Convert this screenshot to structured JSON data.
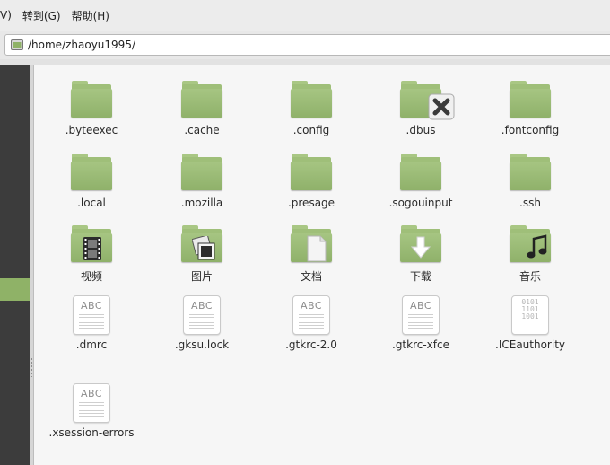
{
  "menu": [
    "V)",
    "转到(G)",
    "帮助(H)"
  ],
  "location": {
    "path": "/home/zhaoyu1995/"
  },
  "files": [
    {
      "name": ".byteexec",
      "type": "folder"
    },
    {
      "name": ".cache",
      "type": "folder"
    },
    {
      "name": ".config",
      "type": "folder"
    },
    {
      "name": ".dbus",
      "type": "folder",
      "emblem": "unreadable-x-icon"
    },
    {
      "name": ".fontconfig",
      "type": "folder"
    },
    {
      "name": ".local",
      "type": "folder"
    },
    {
      "name": ".mozilla",
      "type": "folder"
    },
    {
      "name": ".presage",
      "type": "folder"
    },
    {
      "name": ".sogouinput",
      "type": "folder"
    },
    {
      "name": ".ssh",
      "type": "folder"
    },
    {
      "name": "视频",
      "type": "folder",
      "emblem": "film-icon"
    },
    {
      "name": "图片",
      "type": "folder",
      "emblem": "picture-icon"
    },
    {
      "name": "文档",
      "type": "folder",
      "emblem": "document-icon"
    },
    {
      "name": "下载",
      "type": "folder",
      "emblem": "download-arrow-icon"
    },
    {
      "name": "音乐",
      "type": "folder",
      "emblem": "music-note-icon"
    },
    {
      "name": ".dmrc",
      "type": "text",
      "glyph": "ABC"
    },
    {
      "name": ".gksu.lock",
      "type": "text",
      "glyph": "ABC"
    },
    {
      "name": ".gtkrc-2.0",
      "type": "text",
      "glyph": "ABC"
    },
    {
      "name": ".gtkrc-xfce",
      "type": "text",
      "glyph": "ABC"
    },
    {
      "name": ".ICEauthority",
      "type": "binary",
      "glyph": "0101\n1101\n1001"
    },
    {
      "name": ".xsession-errors",
      "type": "text",
      "glyph": "ABC"
    }
  ],
  "colors": {
    "folder": "#9fbf79",
    "sidebar": "#3c3c3c",
    "sidebar_selected": "#8fb267",
    "content_bg": "#f6f6f6"
  }
}
